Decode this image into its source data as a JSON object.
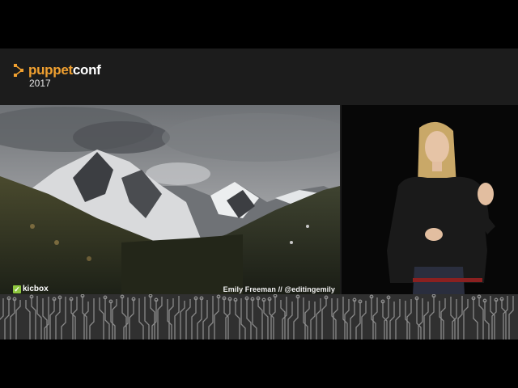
{
  "brand": {
    "name_part1": "puppet",
    "name_part2": "conf",
    "year": "2017",
    "accent_color": "#f0a030"
  },
  "sponsor": {
    "name": "kicbox",
    "check_icon": "checkmark-icon"
  },
  "speaker": {
    "credit": "Emily Freeman  //  @editingemily"
  },
  "slide": {
    "subject": "mountain-landscape-image"
  },
  "camera": {
    "subject": "speaker-video-feed"
  }
}
